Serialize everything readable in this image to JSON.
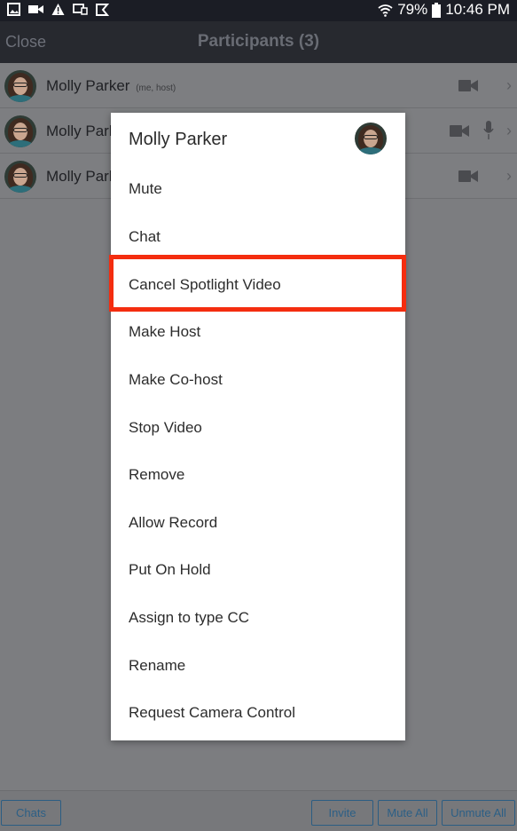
{
  "status_bar": {
    "battery": "79%",
    "time": "10:46 PM"
  },
  "top_bar": {
    "close_label": "Close",
    "title": "Participants (3)"
  },
  "participants": [
    {
      "name": "Molly Parker",
      "tag": "(me, host)"
    },
    {
      "name": "Molly Parker",
      "tag": ""
    },
    {
      "name": "Molly Parker",
      "tag": ""
    }
  ],
  "menu": {
    "title": "Molly Parker",
    "items": [
      "Mute",
      "Chat",
      "Cancel Spotlight Video",
      "Make Host",
      "Make Co-host",
      "Stop Video",
      "Remove",
      "Allow Record",
      "Put On Hold",
      "Assign to type CC",
      "Rename",
      "Request Camera Control"
    ],
    "highlight_color": "#f42d0f"
  },
  "bottom_bar": {
    "chats_label": "Chats",
    "invite_label": "Invite",
    "mute_all_label": "Mute All",
    "unmute_all_label": "Unmute All"
  }
}
